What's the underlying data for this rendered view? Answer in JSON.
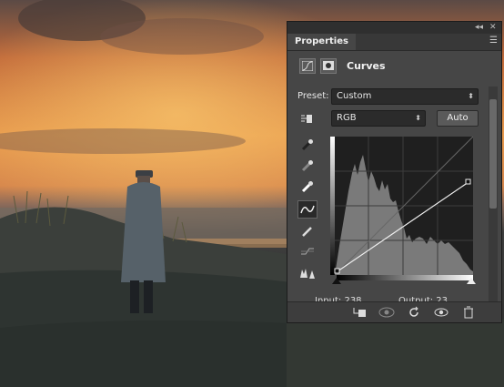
{
  "panel": {
    "tab_label": "Properties",
    "title": "Curves",
    "preset_label": "Preset:",
    "preset_value": "Custom",
    "channel_value": "RGB",
    "auto_label": "Auto",
    "input_label": "Input:",
    "input_value": "238",
    "output_label": "Output:",
    "output_value": "23"
  },
  "icons": {
    "collapse": "double-chevron-left-icon",
    "close": "close-icon",
    "panel_menu": "panel-menu-icon",
    "adjustment": "curves-adjustment-icon",
    "mask": "mask-icon",
    "on_image": "on-image-adjust-hand-icon",
    "sample_black": "black-point-eyedropper-icon",
    "sample_gray": "gray-point-eyedropper-icon",
    "sample_white": "white-point-eyedropper-icon",
    "edit_points": "edit-points-curve-icon",
    "draw": "pencil-draw-icon",
    "smooth": "smooth-curve-icon",
    "clipping": "clipping-warning-icon",
    "clip_to_layer": "clip-to-layer-icon",
    "view_previous": "view-previous-state-icon",
    "reset": "reset-icon",
    "visibility": "visibility-eye-icon",
    "delete": "trash-icon"
  },
  "colors": {
    "panel_bg": "#464646",
    "field_bg": "#2b2b2b",
    "graph_bg": "#1f1f1f"
  }
}
